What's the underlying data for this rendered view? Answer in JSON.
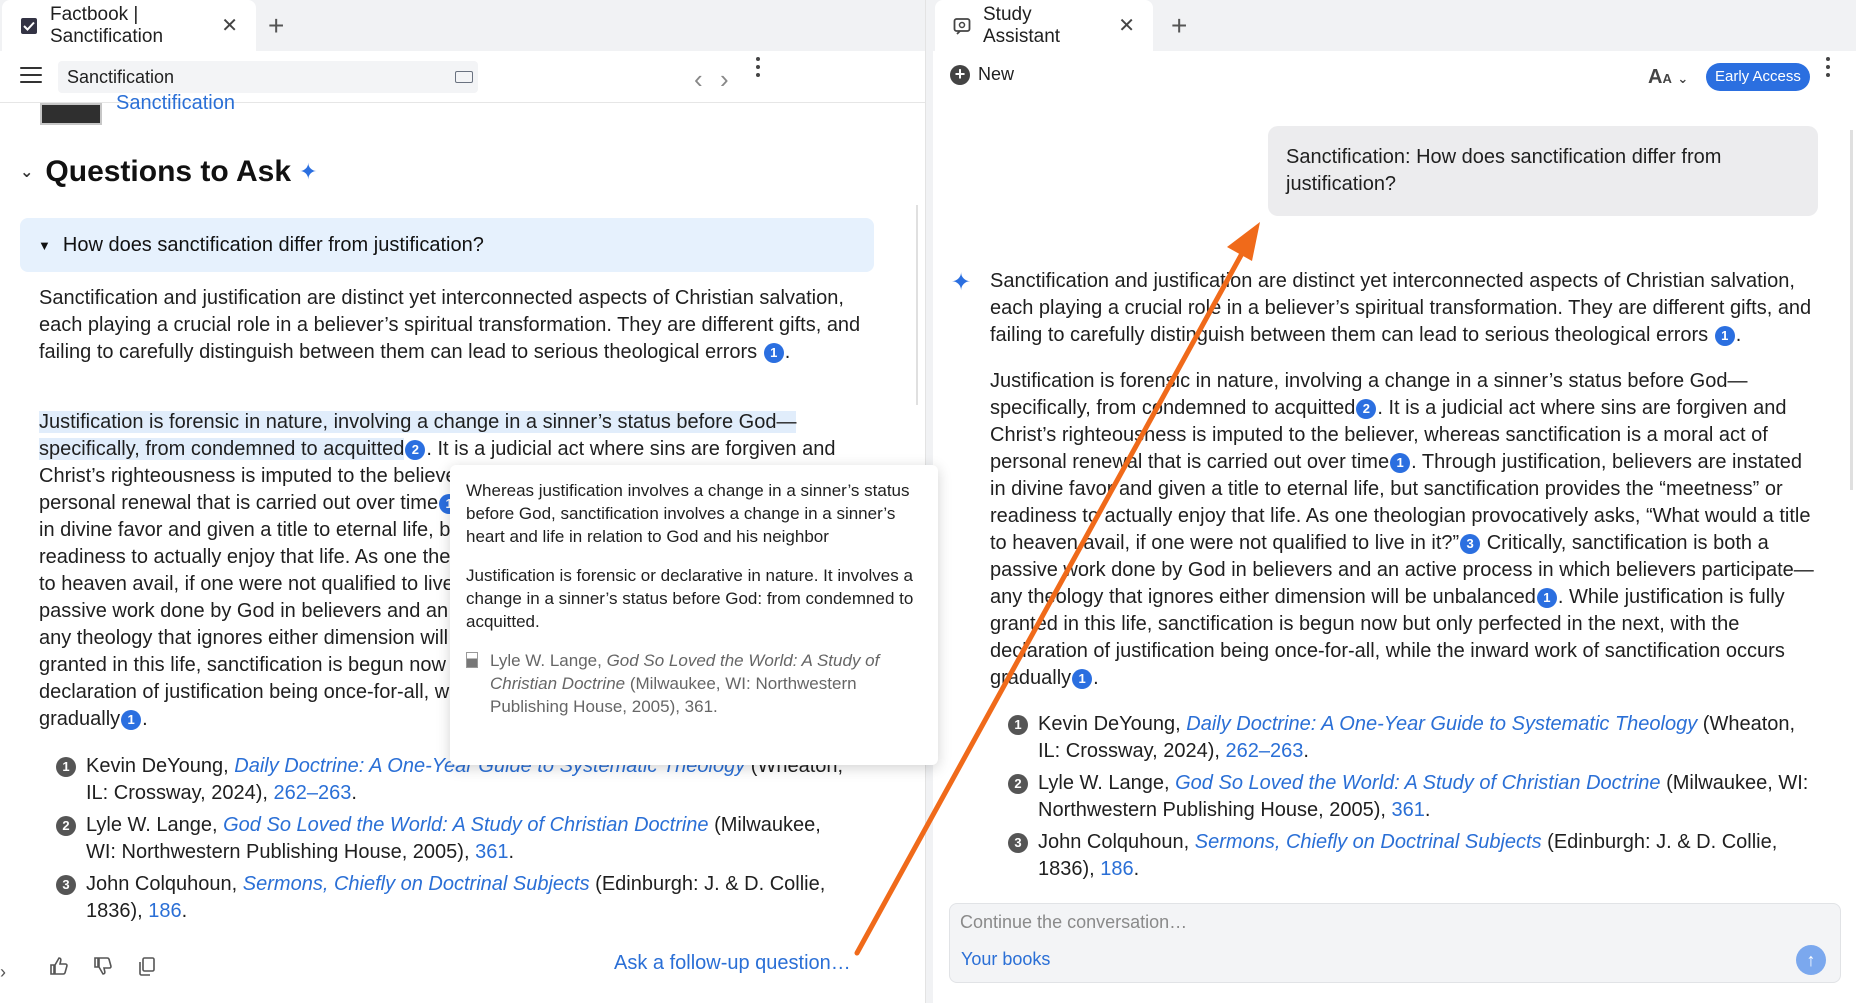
{
  "left_tab": {
    "title": "Factbook | Sanctification",
    "close": "✕",
    "new_tab": "+"
  },
  "right_tab": {
    "title": "Study Assistant",
    "close": "✕",
    "new_tab": "+"
  },
  "left_toolbar": {
    "search_value": "Sanctification",
    "back": "‹",
    "forward": "›"
  },
  "left_content": {
    "thumb_link": "Sanctification",
    "section_title": "Questions to Ask",
    "question": "How does sanctification differ from justification?",
    "para1": {
      "text": "Sanctification and justification are distinct yet interconnected aspects of Christian salvation, each playing a crucial role in a believer’s spiritual transformation. They are different gifts, and failing to carefully distinguish between them can lead to serious theological errors",
      "cite": "1"
    },
    "para2": {
      "highlight": "Justification is forensic in nature, involving a change in a sinner’s status before God—specifically, from condemned to acquitted",
      "cite_a": "2",
      "text_a": ". It is a judicial act where sins are forgiven and Christ’s righteousness is imputed to the believer, whereas sanctification is a moral act of personal renewal that is carried out over time",
      "cite_b": "1",
      "text_b": ". Through justification, believers are instated in divine favor and given a title to eternal life, but sanctification provides the “meetness” or readiness to actually enjoy that life. As one theologian provocatively asks, “What would a title to heaven avail, if one were not qualified to live in it?”",
      "cite_c": "3",
      "text_c": " Critically, sanctification is both a passive work done by God in believers and an active process in which believers participate—any theology that ignores either dimension will be unbalanced",
      "cite_d": "1",
      "text_d": ". While justification is fully granted in this life, sanctification is begun now but only perfected in the next, with the declaration of justification being once-for-all, while the inward work of sanctification occurs gradually",
      "cite_e": "1",
      "end": "."
    },
    "follow_up": "Ask a follow-up question…"
  },
  "references": [
    {
      "num": "1",
      "author": "Kevin DeYoung, ",
      "book": "Daily Doctrine: A One-Year Guide to Systematic Theology",
      "pub": " (Wheaton, IL: Crossway, 2024), ",
      "pages": "262–263",
      "end": "."
    },
    {
      "num": "2",
      "author": "Lyle W. Lange, ",
      "book": "God So Loved the World: A Study of Christian Doctrine",
      "pub": " (Milwaukee, WI: Northwestern Publishing House, 2005), ",
      "pages": "361",
      "end": "."
    },
    {
      "num": "3",
      "author": "John Colquhoun, ",
      "book": "Sermons, Chiefly on Doctrinal Subjects",
      "pub": " (Edinburgh: J. & D. Collie, 1836), ",
      "pages": "186",
      "end": "."
    }
  ],
  "tooltip": {
    "p1": "Whereas justification involves a change in a sinner’s status before God, sanctification involves a change in a sinner’s heart and life in relation to God and his neighbor",
    "p2": "Justification is forensic or declarative in nature. It involves a change in a sinner’s status before God: from condemned to acquitted.",
    "src_author": "Lyle W. Lange, ",
    "src_book": "God So Loved the World: A Study of Christian Doctrine",
    "src_pub": " (Milwaukee, WI: Northwestern Publishing House, 2005), 361."
  },
  "right_toolbar": {
    "new_label": "New",
    "text_size": "A",
    "text_size_small": "A",
    "badge": "Early Access"
  },
  "chat": {
    "user_message": "Sanctification: How does sanctification differ from justification?",
    "input_placeholder": "Continue the conversation…",
    "your_books": "Your books",
    "send": "↑"
  },
  "colors": {
    "accent": "#2b6fe0",
    "annotation_arrow": "#f06a1a",
    "highlight": "#e1edfb"
  }
}
